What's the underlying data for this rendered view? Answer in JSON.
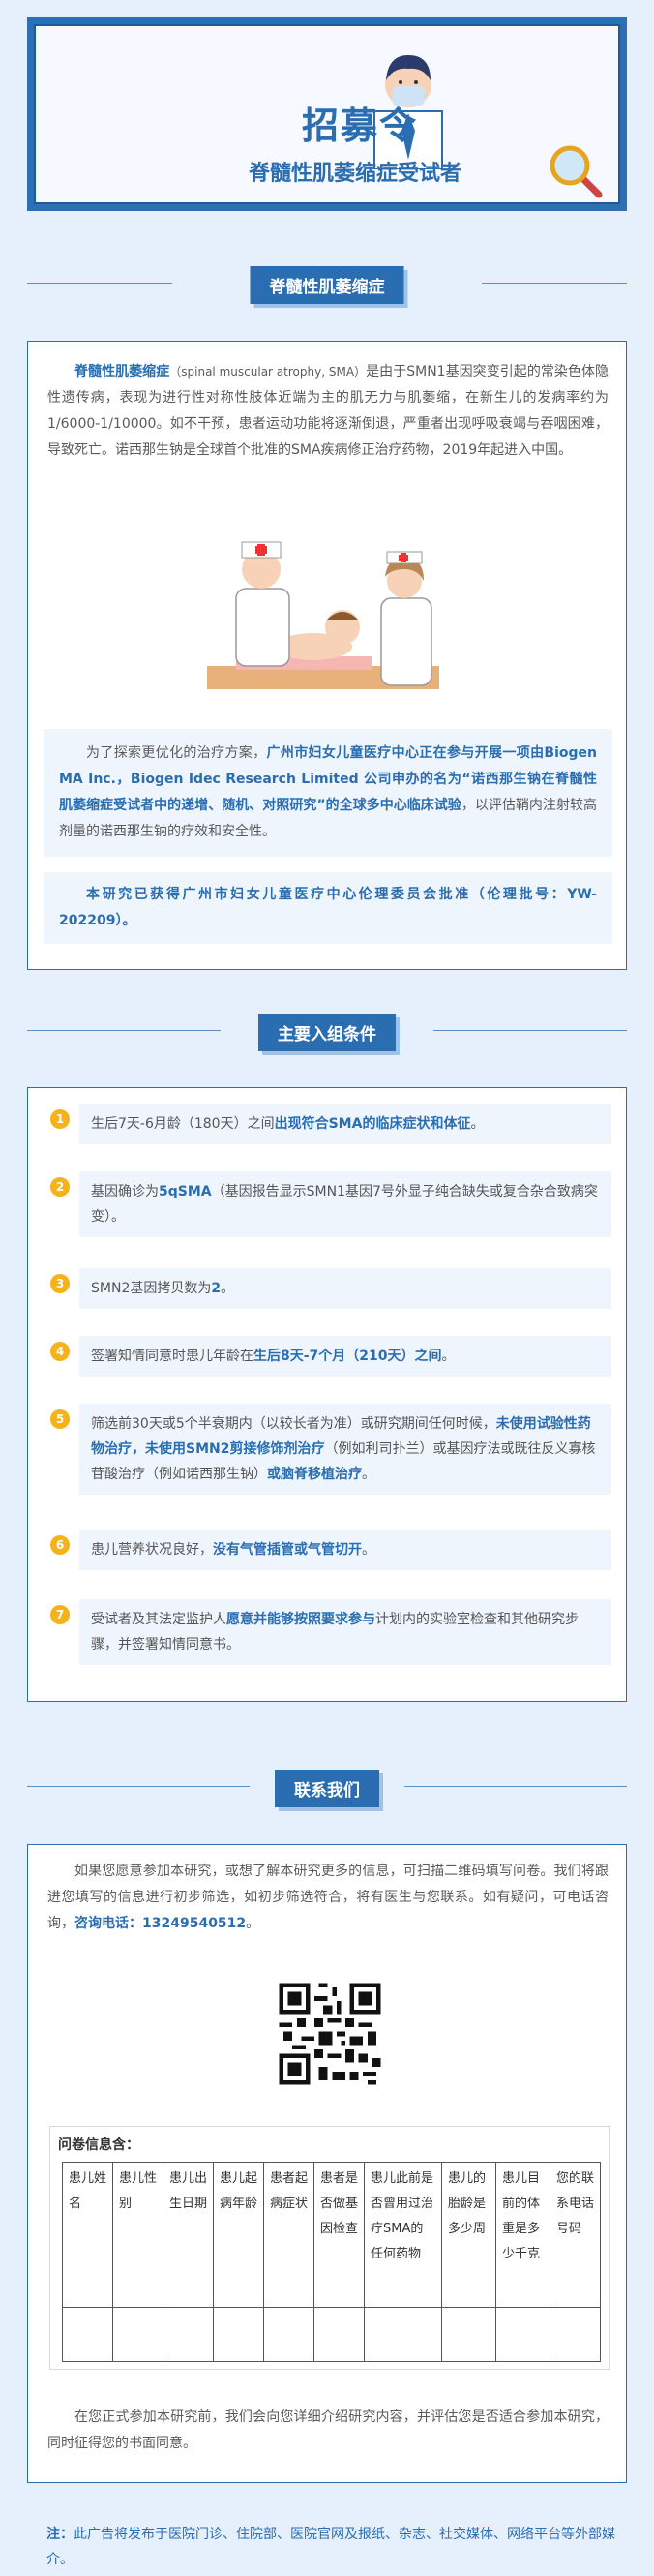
{
  "banner": {
    "title": "招募令",
    "subtitle": "脊髓性肌萎缩症受试者"
  },
  "section1": {
    "heading": "脊髓性肌萎缩症",
    "intro_bold": "脊髓性肌萎缩症",
    "intro_en": "（spinal muscular atrophy, SMA）",
    "intro_rest": "是由于SMN1基因突变引起的常染色体隐性遗传病，表现为进行性对称性肢体近端为主的肌无力与肌萎缩，在新生儿的发病率约为1/6000-1/10000。如不干预，患者运动功能将逐渐倒退，严重者出现呼吸衰竭与吞咽困难，导致死亡。诺西那生钠是全球首个批准的SMA疾病修正治疗药物，2019年起进入中国。",
    "study_pre": "为了探索更优化的治疗方案，",
    "study_bold": "广州市妇女儿童医疗中心正在参与开展一项由Biogen MA Inc.，Biogen Idec Research Limited 公司申办的名为“诺西那生钠在脊髓性肌萎缩症受试者中的递增、随机、对照研究”的全球多中心临床试验",
    "study_post": "，以评估鞘内注射较高剂量的诺西那生钠的疗效和安全性。",
    "ethics": "本研究已获得广州市妇女儿童医疗中心伦理委员会批准（伦理批号：YW-202209）。"
  },
  "section2": {
    "heading": "主要入组条件",
    "items": [
      {
        "num": "1",
        "a": "生后7天-6月龄（180天）之间",
        "b": "出现符合SMA的临床症状和体征",
        "c": "。"
      },
      {
        "num": "2",
        "a": "基因确诊为",
        "b": "5qSMA",
        "c": "（基因报告显示SMN1基因7号外显子纯合缺失或复合杂合致病突变）。"
      },
      {
        "num": "3",
        "a": "SMN2基因拷贝数为",
        "b": "2",
        "c": "。"
      },
      {
        "num": "4",
        "a": "签署知情同意时患儿年龄在",
        "b": "生后8天-7个月（210天）之间",
        "c": "。"
      },
      {
        "num": "5",
        "a": "筛选前30天或5个半衰期内（以较长者为准）或研究期间任何时候，",
        "b": "未使用试验性药物治疗，未使用SMN2剪接修饰剂治疗",
        "c": "（例如利司扑兰）或基因疗法或既往反义寡核苷酸治疗（例如诺西那生钠）",
        "d": "或脑脊移植治疗",
        "e": "。"
      },
      {
        "num": "6",
        "a": "患儿营养状况良好，",
        "b": "没有气管插管或气管切开",
        "c": "。"
      },
      {
        "num": "7",
        "a": "受试者及其法定监护人",
        "b": "愿意并能够按照要求参与",
        "c": "计划内的实验室检查和其他研究步骤，并签署知情同意书。"
      }
    ]
  },
  "section3": {
    "heading": "联系我们",
    "contact_text": "如果您愿意参加本研究，或想了解本研究更多的信息，可扫描二维码填写问卷。我们将跟进您填写的信息进行初步筛选，如初步筛选符合，将有医生与您联系。如有疑问，可电话咨询，",
    "contact_phone": "咨询电话：13249540512",
    "contact_end": "。",
    "form_title": "问卷信息含：",
    "table_headers": [
      "患儿姓名",
      "患儿性别",
      "患儿出生日期",
      "患儿起病年龄",
      "患者起病症状",
      "患者是否做基因检查",
      "患儿此前是否曾用过治疗SMA的任何药物",
      "患儿的胎龄是多少周",
      "患儿目前的体重是多少千克",
      "您的联系电话号码"
    ],
    "closing": "在您正式参加本研究前，我们会向您详细介绍研究内容，并评估您是否适合参加本研究，同时征得您的书面同意。"
  },
  "footer": {
    "label": "注：",
    "text": "此广告将发布于医院门诊、住院部、医院官网及报纸、杂志、社交媒体、网络平台等外部媒介。"
  },
  "colors": {
    "accent": "#2a6db0",
    "badge": "#f5b21b",
    "background": "#e6f0fc"
  }
}
